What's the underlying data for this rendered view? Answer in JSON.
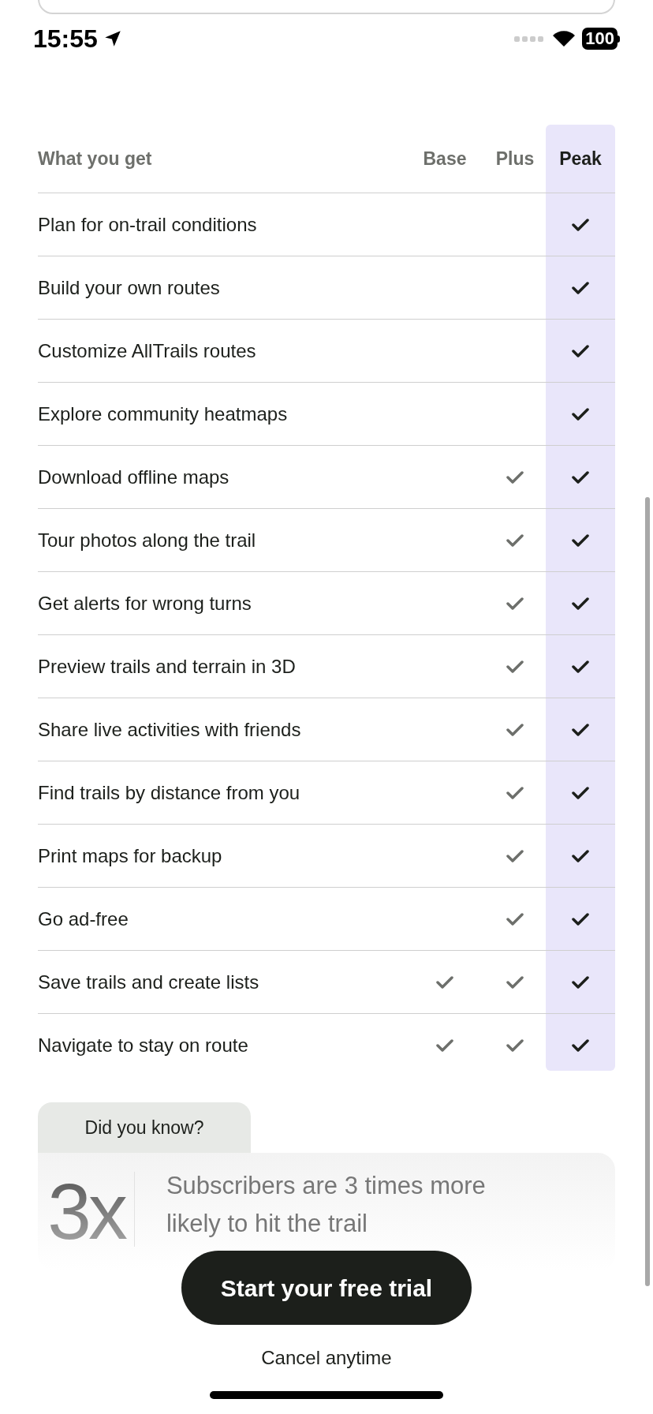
{
  "status_bar": {
    "time": "15:55",
    "battery": "100"
  },
  "table": {
    "heading": "What you get",
    "plans": [
      {
        "label": "Base",
        "selected": false
      },
      {
        "label": "Plus",
        "selected": false
      },
      {
        "label": "Peak",
        "selected": true
      }
    ],
    "rows": [
      {
        "feature": "Plan for on-trail conditions",
        "included": [
          false,
          false,
          true
        ]
      },
      {
        "feature": "Build your own routes",
        "included": [
          false,
          false,
          true
        ]
      },
      {
        "feature": "Customize AllTrails routes",
        "included": [
          false,
          false,
          true
        ]
      },
      {
        "feature": "Explore community heatmaps",
        "included": [
          false,
          false,
          true
        ]
      },
      {
        "feature": "Download offline maps",
        "included": [
          false,
          true,
          true
        ]
      },
      {
        "feature": "Tour photos along the trail",
        "included": [
          false,
          true,
          true
        ]
      },
      {
        "feature": "Get alerts for wrong turns",
        "included": [
          false,
          true,
          true
        ]
      },
      {
        "feature": "Preview trails and terrain in 3D",
        "included": [
          false,
          true,
          true
        ]
      },
      {
        "feature": "Share live activities with friends",
        "included": [
          false,
          true,
          true
        ]
      },
      {
        "feature": "Find trails by distance from you",
        "included": [
          false,
          true,
          true
        ]
      },
      {
        "feature": "Print maps for backup",
        "included": [
          false,
          true,
          true
        ]
      },
      {
        "feature": "Go ad-free",
        "included": [
          false,
          true,
          true
        ]
      },
      {
        "feature": "Save trails and create lists",
        "included": [
          true,
          true,
          true
        ]
      },
      {
        "feature": "Navigate to stay on route",
        "included": [
          true,
          true,
          true
        ]
      }
    ]
  },
  "did_you_know": {
    "tab": "Did you know?",
    "stat": "3x",
    "text": "Subscribers are 3 times more likely to hit the trail"
  },
  "cta_button": "Start your free trial",
  "footnote": "Cancel anytime"
}
